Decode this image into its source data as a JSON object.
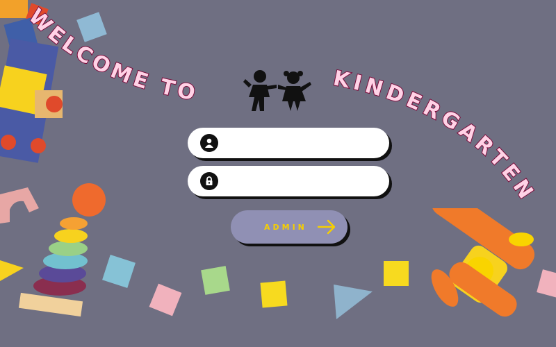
{
  "title_line": "WELCOME TO",
  "title_word": "KINDERGARTEN",
  "username_field": {
    "placeholder": ""
  },
  "password_field": {
    "placeholder": ""
  },
  "submit": {
    "label": "ADMIN"
  },
  "colors": {
    "background": "#6f6f82",
    "title_fill": "#ffd2e6",
    "title_stroke": "#7a0b3a",
    "button": "#9090b4",
    "button_text": "#f6cf00"
  },
  "icons": [
    "user-icon",
    "lock-icon",
    "arrow-right-icon",
    "children-icon"
  ]
}
